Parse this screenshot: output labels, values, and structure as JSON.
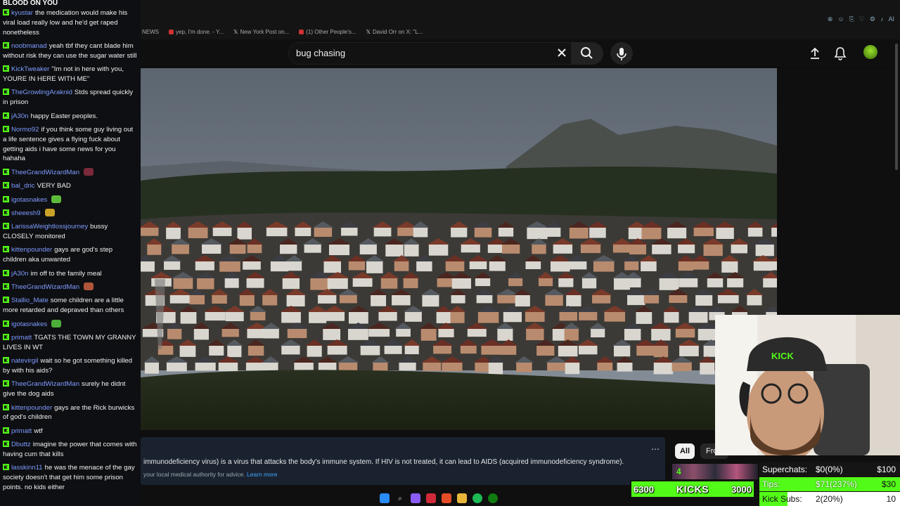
{
  "browser": {
    "bookmarks": [
      "NEWS",
      "yep, I'm done. - Y...",
      "New York Post on...",
      "(1) Other People's...",
      "David Orr on X: \"L..."
    ]
  },
  "youtube": {
    "search_value": "bug chasing"
  },
  "info_panel": {
    "text": "immunodeficiency virus) is a virus that attacks the body's immune system. If HIV is not treated, it can lead to AIDS (acquired immunodeficiency syndrome).",
    "sub_text": "your local medical authority for advice.",
    "learn_more": "Learn more"
  },
  "chips": {
    "all": "All",
    "from": "Fro"
  },
  "chat": {
    "title": "BLOOD ON YOU",
    "messages": [
      {
        "user": "kyustar",
        "text": "the medication would make his viral load really low and he'd get raped nonetheless"
      },
      {
        "user": "noobmanad",
        "text": "yeah tbf they cant blade him without risk they can use the sugar water still"
      },
      {
        "user": "KickTweaker",
        "text": "\"Im not in here with you, YOURE IN HERE WITH ME\""
      },
      {
        "user": "TheGrowlingAraknid",
        "text": "Stds spread quickly in prison"
      },
      {
        "user": "jA30n",
        "text": "happy Easter peoples."
      },
      {
        "user": "Normo92",
        "text": "if you think some guy living out a life sentence gives a flying fuck about getting aids i have some news for you hahaha"
      },
      {
        "user": "TheeGrandWizardMan",
        "text": "",
        "emote": "#7a2a3a"
      },
      {
        "user": "bal_dric",
        "text": "VERY BAD"
      },
      {
        "user": "igotasnakes",
        "text": "",
        "emote": "#5dbb3c"
      },
      {
        "user": "sheeesh9",
        "text": "",
        "emote": "#c9a227"
      },
      {
        "user": "LarissaWeightlossjourney",
        "text": "bussy CLOSELY monitored"
      },
      {
        "user": "kittenpounder",
        "text": "gays are god's step children aka unwanted"
      },
      {
        "user": "jA30n",
        "text": "im off to the family meal"
      },
      {
        "user": "TheeGrandWizardMan",
        "text": "",
        "emote": "#b0553a"
      },
      {
        "user": "Stallio_Mate",
        "text": "some children are a little more retarded and depraved than others"
      },
      {
        "user": "igotasnakes",
        "text": "",
        "emote": "#4caf3a"
      },
      {
        "user": "primatt",
        "text": "TGATS THE TOWN MY GRANNY LIVES IN WT"
      },
      {
        "user": "natevirgil",
        "text": "wait so he got something killed by with his aids?"
      },
      {
        "user": "TheeGrandWizardMan",
        "text": "surely he didnt give the dog aids"
      },
      {
        "user": "kittenpounder",
        "text": "gays are the Rick burwicks of god's children"
      },
      {
        "user": "primatt",
        "text": "wtf"
      },
      {
        "user": "Dbuttz",
        "text": "imagine the power that comes with having cum that kills"
      },
      {
        "user": "lasskinn11",
        "text": "he was the menace of the gay society doesn't that get him some prison points. no kids either"
      }
    ]
  },
  "goal_bar": {
    "current": "6300",
    "label": "KICKS",
    "target": "3000",
    "badge": "4"
  },
  "stats": {
    "superchats": {
      "label": "Superchats:",
      "value": "$0(0%)",
      "goal": "$100",
      "progress": 0
    },
    "tips": {
      "label": "Tips:",
      "value": "$71(237%)",
      "goal": "$30",
      "progress": 1
    },
    "subs": {
      "label": "Kick Subs:",
      "value": "2(20%)",
      "goal": "10",
      "progress": 0.2
    }
  },
  "colors": {
    "kick_green": "#53fc18",
    "chat_user": "#7d9cff",
    "yt_bg": "#0f0f0f"
  }
}
